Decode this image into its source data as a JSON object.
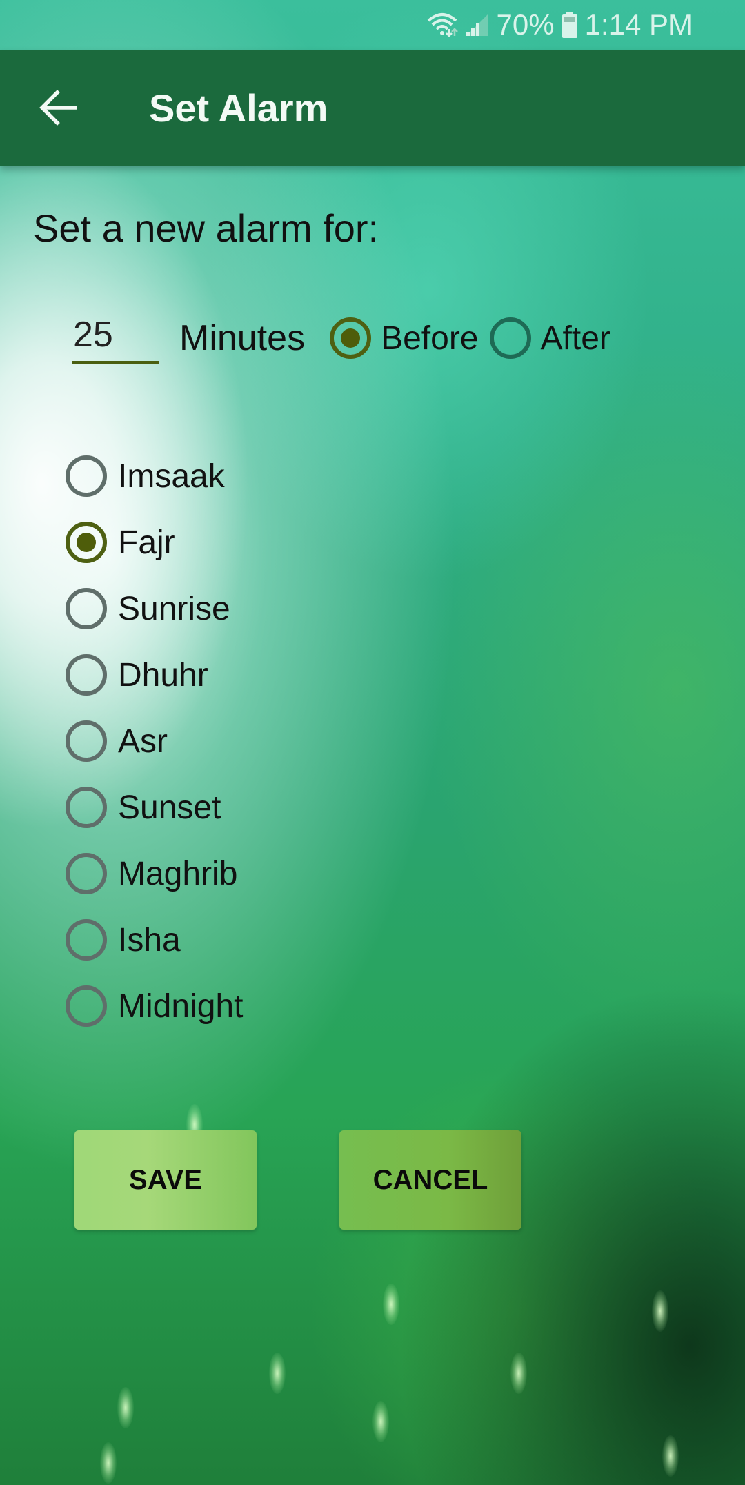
{
  "status_bar": {
    "wifi_icon": "wifi-icon",
    "signal_icon": "signal-icon",
    "battery_percent": "70%",
    "battery_icon": "battery-icon",
    "time": "1:14 PM"
  },
  "app_bar": {
    "back_icon": "arrow-left-icon",
    "title": "Set Alarm"
  },
  "form": {
    "prompt": "Set a new alarm for:",
    "minutes_value": "25",
    "minutes_label": "Minutes",
    "timing_options": [
      {
        "label": "Before",
        "checked": true
      },
      {
        "label": "After",
        "checked": false
      }
    ],
    "prayers": [
      {
        "label": "Imsaak",
        "checked": false
      },
      {
        "label": "Fajr",
        "checked": true
      },
      {
        "label": "Sunrise",
        "checked": false
      },
      {
        "label": "Dhuhr",
        "checked": false
      },
      {
        "label": "Asr",
        "checked": false
      },
      {
        "label": "Sunset",
        "checked": false
      },
      {
        "label": "Maghrib",
        "checked": false
      },
      {
        "label": "Isha",
        "checked": false
      },
      {
        "label": "Midnight",
        "checked": false
      }
    ]
  },
  "buttons": {
    "save_label": "SAVE",
    "cancel_label": "CANCEL"
  },
  "colors": {
    "app_bar": "#1b6a3d",
    "radio_checked": "#4e6012",
    "radio_unchecked": "#5f6e6a",
    "save_button": "#a6d879",
    "cancel_button": "#7bb946"
  }
}
